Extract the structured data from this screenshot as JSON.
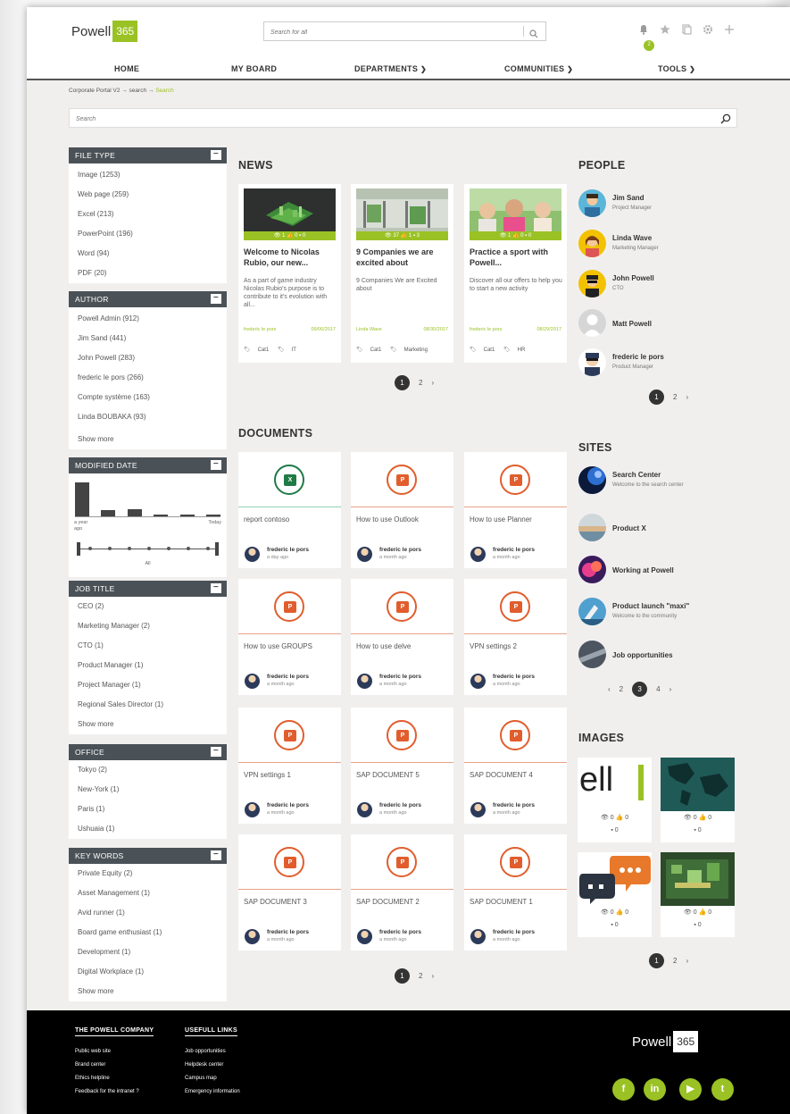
{
  "header": {
    "logo_word": "Powell",
    "logo_box": "365",
    "search_placeholder": "Search for all",
    "bell_count": "2"
  },
  "nav": {
    "home": "HOME",
    "my_board": "MY BOARD",
    "departments": "DEPARTMENTS",
    "communities": "COMMUNITIES",
    "tools": "TOOLS"
  },
  "breadcrumb": {
    "part1": "Corporate Portal V2 → search → ",
    "current": "Search"
  },
  "main_search": {
    "placeholder": "Search"
  },
  "facets": {
    "file_type": {
      "title": "FILE TYPE",
      "items": [
        "Image (1253)",
        "Web page (259)",
        "Excel (213)",
        "PowerPoint (196)",
        "Word (94)",
        "PDF (20)"
      ]
    },
    "author": {
      "title": "AUTHOR",
      "items": [
        "Powell Admin (912)",
        "Jim Sand (441)",
        "John Powell (283)",
        "frederic le pors (266)",
        "Compte système (163)",
        "Linda BOUBAKA (93)"
      ],
      "show_more": "Show more"
    },
    "modified_date": {
      "title": "MODIFIED DATE",
      "left_label_1": "a year",
      "left_label_2": "ago",
      "right_label": "Today",
      "slider_label": "All",
      "bar_levels": [
        1.0,
        0.18,
        0.22,
        0.06,
        0.05,
        0.05
      ]
    },
    "job_title": {
      "title": "JOB TITLE",
      "items": [
        "CEO (2)",
        "Marketing Manager (2)",
        "CTO (1)",
        "Product Manager (1)",
        "Project Manager (1)",
        "Regional Sales Director (1)"
      ],
      "show_more": "Show more"
    },
    "office": {
      "title": "OFFICE",
      "items": [
        "Tokyo (2)",
        "New-York (1)",
        "Paris (1)",
        "Ushuaia (1)"
      ]
    },
    "key_words": {
      "title": "KEY WORDS",
      "items": [
        "Private Equity (2)",
        "Asset Management (1)",
        "Avid runner (1)",
        "Board game enthusiast (1)",
        "Development (1)",
        "Digital Workplace (1)"
      ],
      "show_more": "Show more"
    }
  },
  "news": {
    "title": "NEWS",
    "cards": [
      {
        "stats": "👁 1  👍 0  ▪ 0",
        "title": "Welcome to Nicolas Rubio, our new...",
        "desc": "As a part of game industry Nicolas Rubio's purpose is to contribute to it's evolution with all...",
        "author": "frederic le pors",
        "date": "09/06/2017",
        "tags": [
          "Cat1",
          "IT"
        ]
      },
      {
        "stats": "👁 37  👍 1  ▪ 3",
        "title": "9 Companies we are excited about",
        "desc": "9 Companies We are Excited about",
        "author": "Linda Wave",
        "date": "08/30/2017",
        "tags": [
          "Cat1",
          "Marketing"
        ]
      },
      {
        "stats": "👁 1  👍 0  ▪ 0",
        "title": "Practice a sport with Powell...",
        "desc": "Discover all our offers to help you to start a new activity",
        "author": "frederic le pors",
        "date": "08/29/2017",
        "tags": [
          "Cat1",
          "HR"
        ]
      }
    ],
    "pager": {
      "current": "1",
      "next_page": "2",
      "next": "›"
    }
  },
  "documents": {
    "title": "DOCUMENTS",
    "items": [
      {
        "name": "report contoso",
        "type": "xls",
        "author": "frederic le pors",
        "time": "a day ago"
      },
      {
        "name": "How to use Outlook",
        "type": "ppt",
        "author": "frederic le pors",
        "time": "a month ago"
      },
      {
        "name": "How to use Planner",
        "type": "ppt",
        "author": "frederic le pors",
        "time": "a month ago"
      },
      {
        "name": "How to use GROUPS",
        "type": "ppt",
        "author": "frederic le pors",
        "time": "a month ago"
      },
      {
        "name": "How to use delve",
        "type": "ppt",
        "author": "frederic le pors",
        "time": "a month ago"
      },
      {
        "name": "VPN settings 2",
        "type": "ppt",
        "author": "frederic le pors",
        "time": "a month ago"
      },
      {
        "name": "VPN settings 1",
        "type": "ppt",
        "author": "frederic le pors",
        "time": "a month ago"
      },
      {
        "name": "SAP DOCUMENT 5",
        "type": "ppt",
        "author": "frederic le pors",
        "time": "a month ago"
      },
      {
        "name": "SAP DOCUMENT 4",
        "type": "ppt",
        "author": "frederic le pors",
        "time": "a month ago"
      },
      {
        "name": "SAP DOCUMENT 3",
        "type": "ppt",
        "author": "frederic le pors",
        "time": "a month ago"
      },
      {
        "name": "SAP DOCUMENT 2",
        "type": "ppt",
        "author": "frederic le pors",
        "time": "a month ago"
      },
      {
        "name": "SAP DOCUMENT 1",
        "type": "ppt",
        "author": "frederic le pors",
        "time": "a month ago"
      }
    ],
    "pager": {
      "current": "1",
      "next_page": "2",
      "next": "›"
    }
  },
  "people": {
    "title": "PEOPLE",
    "items": [
      {
        "name": "Jim Sand",
        "role": "Project Manager"
      },
      {
        "name": "Linda Wave",
        "role": "Marketing Manager"
      },
      {
        "name": "John Powell",
        "role": "CTO"
      },
      {
        "name": "Matt Powell",
        "role": ""
      },
      {
        "name": "frederic le pors",
        "role": "Product Manager"
      }
    ],
    "pager": {
      "current": "1",
      "next_page": "2",
      "next": "›"
    }
  },
  "sites": {
    "title": "SITES",
    "items": [
      {
        "name": "Search Center",
        "desc": "Welcome to the search center"
      },
      {
        "name": "Product X",
        "desc": ""
      },
      {
        "name": "Working at Powell",
        "desc": ""
      },
      {
        "name": "Product launch \"maxi\"",
        "desc": "Welcome to the community"
      },
      {
        "name": "Job opportunities",
        "desc": ""
      }
    ],
    "pager": {
      "prev": "‹",
      "page_a": "2",
      "current": "3",
      "page_b": "4",
      "next": "›"
    }
  },
  "images": {
    "title": "IMAGES",
    "items": [
      {
        "thumb_text": "ell",
        "views": "0",
        "likes": "0",
        "comments": "0"
      },
      {
        "thumb_text": "",
        "views": "0",
        "likes": "0",
        "comments": "0"
      },
      {
        "thumb_text": "",
        "views": "0",
        "likes": "0",
        "comments": "0"
      },
      {
        "thumb_text": "",
        "views": "0",
        "likes": "0",
        "comments": "0"
      }
    ],
    "pager": {
      "current": "1",
      "next_page": "2",
      "next": "›"
    }
  },
  "footer": {
    "col1_title": "THE POWELL COMPANY",
    "col1_links": [
      "Public web site",
      "Brand center",
      "Ethics helpline",
      "Feedback for the intranet ?"
    ],
    "col2_title": "USEFULL LINKS",
    "col2_links": [
      "Job opportunities",
      "Helpdesk center",
      "Campus map",
      "Emergency information"
    ],
    "logo_word": "Powell",
    "logo_box": "365",
    "social": [
      "f",
      "in",
      "▶",
      "t"
    ]
  },
  "colors": {
    "accent": "#9ac224",
    "facet_header": "#4b5257",
    "ppt": "#e15d2d",
    "xls": "#1f7a46"
  }
}
